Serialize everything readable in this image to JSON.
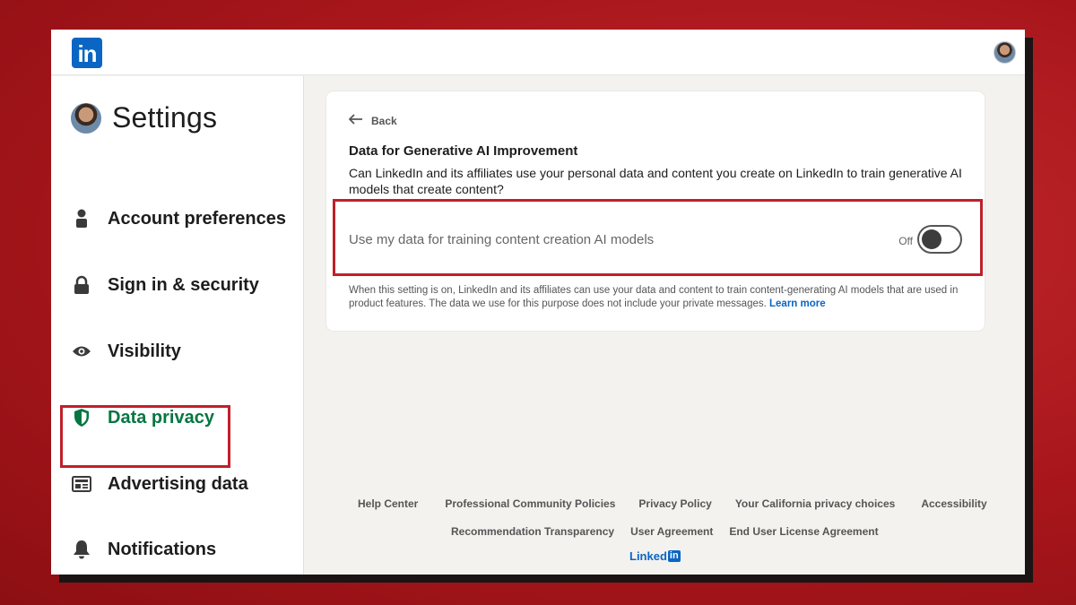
{
  "header": {
    "logo_text": "in"
  },
  "sidebar": {
    "title": "Settings",
    "items": [
      {
        "label": "Account preferences",
        "icon": "person-icon"
      },
      {
        "label": "Sign in & security",
        "icon": "lock-icon"
      },
      {
        "label": "Visibility",
        "icon": "eye-icon"
      },
      {
        "label": "Data privacy",
        "icon": "shield-icon",
        "active": true
      },
      {
        "label": "Advertising data",
        "icon": "newspaper-icon"
      },
      {
        "label": "Notifications",
        "icon": "bell-icon"
      }
    ]
  },
  "card": {
    "back_label": "Back",
    "title": "Data for Generative AI Improvement",
    "description": "Can LinkedIn and its affiliates use your personal data and content you create on LinkedIn to train generative AI models that create content?",
    "setting_label": "Use my data for training content creation AI models",
    "toggle_state": "Off",
    "toggle_on": false,
    "help_text": "When this setting is on, LinkedIn and its affiliates can use your data and content to train content-generating AI models that are used in product features. The data we use for this purpose does not include your private messages.",
    "learn_more": "Learn more"
  },
  "footer": {
    "row1": [
      "Help Center",
      "Professional Community Policies",
      "Privacy Policy",
      "Your California privacy choices",
      "Accessibility"
    ],
    "row2": [
      "Recommendation Transparency",
      "User Agreement",
      "End User License Agreement"
    ],
    "brand_text": "Linked",
    "brand_badge": "in"
  },
  "colors": {
    "accent": "#0a66c2",
    "active_nav": "#057642",
    "highlight": "#c0202a"
  }
}
